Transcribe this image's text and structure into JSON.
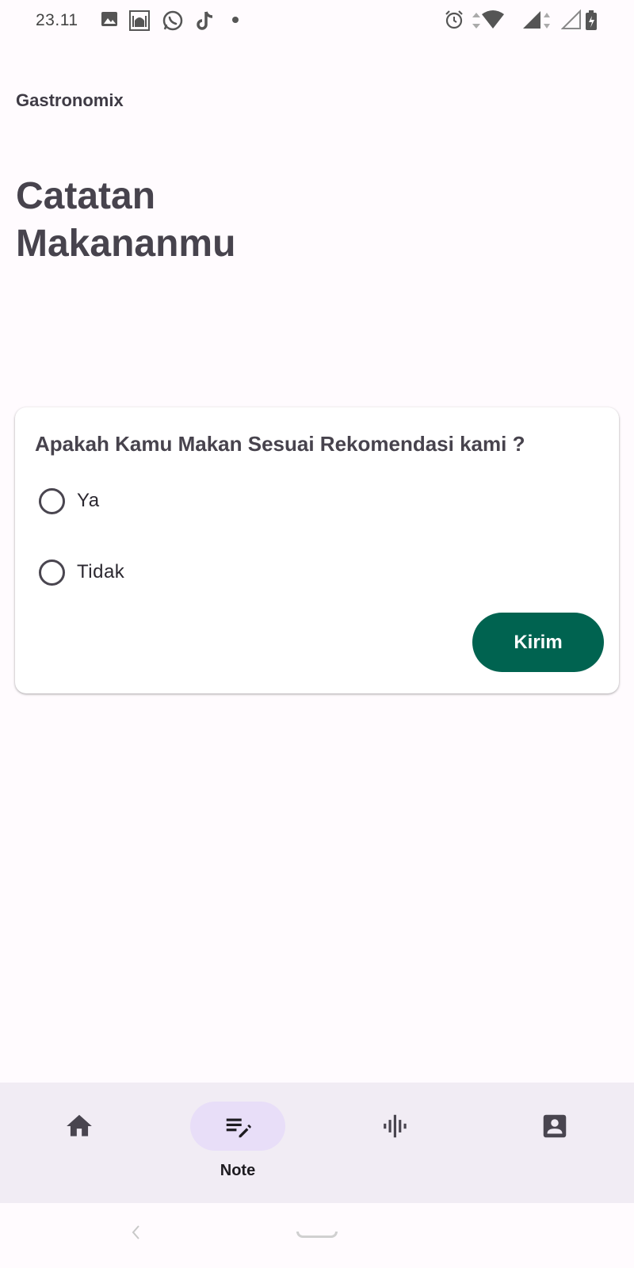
{
  "status_bar": {
    "time": "23.11",
    "left_icons": [
      "image-icon",
      "mosque-app-icon",
      "whatsapp-icon",
      "tiktok-icon",
      "dot-icon"
    ],
    "right_icons": [
      "alarm-icon",
      "wifi-icon",
      "signal-icon",
      "signal-empty-icon",
      "battery-icon"
    ]
  },
  "app": {
    "name": "Gastronomix"
  },
  "page": {
    "title": "Catatan Makananmu"
  },
  "survey": {
    "question": "Apakah Kamu Makan Sesuai Rekomendasi kami ?",
    "options": [
      {
        "label": "Ya",
        "selected": false
      },
      {
        "label": "Tidak",
        "selected": false
      }
    ],
    "submit_label": "Kirim"
  },
  "bottom_nav": {
    "items": [
      {
        "icon": "home-icon",
        "label": "",
        "active": false
      },
      {
        "icon": "note-edit-icon",
        "label": "Note",
        "active": true
      },
      {
        "icon": "audio-wave-icon",
        "label": "",
        "active": false
      },
      {
        "icon": "profile-icon",
        "label": "",
        "active": false
      }
    ]
  },
  "colors": {
    "accent": "#006350",
    "background": "#fffbfe",
    "nav_background": "#f1ecf4",
    "active_indicator": "#e8def8",
    "text": "#47434d"
  }
}
